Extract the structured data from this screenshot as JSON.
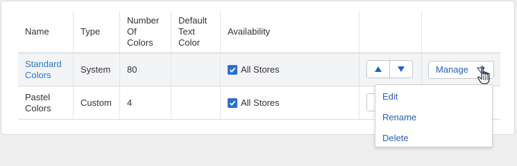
{
  "table": {
    "headers": {
      "name": "Name",
      "type": "Type",
      "number_of_colors": [
        "Number",
        "Of",
        "Colors"
      ],
      "default_text_color": [
        "Default",
        "Text",
        "Color"
      ],
      "availability": "Availability"
    },
    "rows": [
      {
        "name": [
          "Standard",
          "Colors"
        ],
        "type": "System",
        "count": "80",
        "availability": "All Stores",
        "available_checked": true
      },
      {
        "name": [
          "Pastel",
          "Colors"
        ],
        "type": "Custom",
        "count": "4",
        "availability": "All Stores",
        "available_checked": true
      }
    ]
  },
  "manage_button": {
    "label": "Manage",
    "icon": "chevron-down-icon"
  },
  "order_buttons": {
    "up_icon": "arrow-up-icon",
    "down_icon": "arrow-down-icon"
  },
  "dropdown_menu": {
    "items": [
      "Edit",
      "Rename",
      "Delete"
    ]
  },
  "colors": {
    "link": "#2a77c9",
    "accent": "#2b6fd1",
    "selected_row": "#f3f4f6"
  }
}
